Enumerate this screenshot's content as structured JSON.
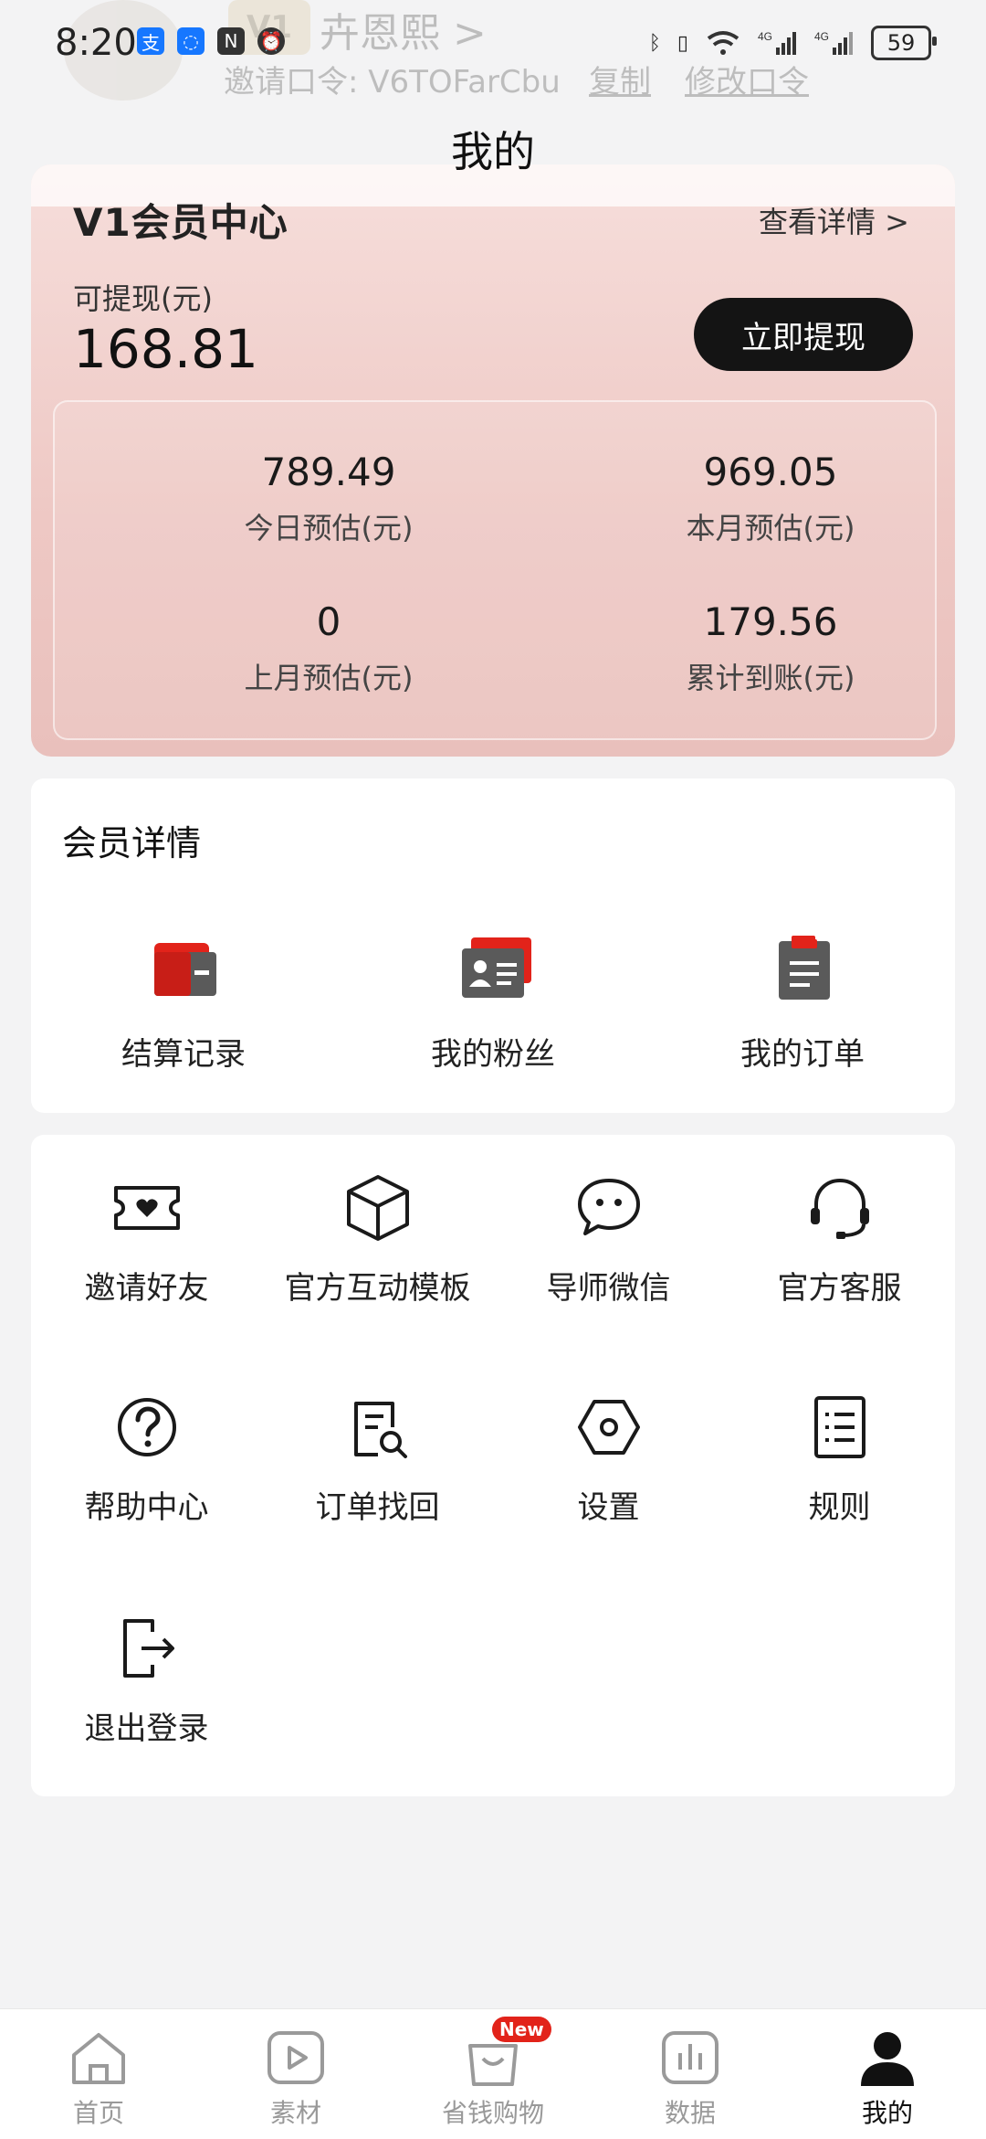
{
  "status_bar": {
    "time": "8:20",
    "battery": "59",
    "icons": [
      "alipay-icon",
      "bulb-icon",
      "nfc-icon",
      "alarm-icon",
      "bluetooth-icon",
      "vibrate-icon",
      "wifi-icon",
      "4g-signal-icon",
      "4g-signal-icon"
    ]
  },
  "profile_ghost": {
    "badge": "V1",
    "name": "卉恩熙 >",
    "invite": "邀请口令: V6TOFarCbu",
    "copy": "复制",
    "modify": "修改口令"
  },
  "page_title": "我的",
  "member_card": {
    "title": "V1会员中心",
    "detail_link": "查看详情 >",
    "withdraw_label": "可提现(元)",
    "withdraw_amount": "168.81",
    "withdraw_button": "立即提现",
    "stats": [
      {
        "value": "789.49",
        "label": "今日预估(元)"
      },
      {
        "value": "969.05",
        "label": "本月预估(元)"
      },
      {
        "value": "0",
        "label": "上月预估(元)"
      },
      {
        "value": "179.56",
        "label": "累计到账(元)"
      }
    ]
  },
  "member_details": {
    "title": "会员详情",
    "items": [
      {
        "label": "结算记录",
        "icon": "wallet-icon"
      },
      {
        "label": "我的粉丝",
        "icon": "id-card-icon"
      },
      {
        "label": "我的订单",
        "icon": "clipboard-icon"
      }
    ]
  },
  "tools": [
    {
      "label": "邀请好友",
      "icon": "ticket-heart-icon"
    },
    {
      "label": "官方互动模板",
      "icon": "cube-icon"
    },
    {
      "label": "导师微信",
      "icon": "chat-bubble-icon"
    },
    {
      "label": "官方客服",
      "icon": "headset-icon"
    },
    {
      "label": "帮助中心",
      "icon": "help-circle-icon"
    },
    {
      "label": "订单找回",
      "icon": "doc-search-icon"
    },
    {
      "label": "设置",
      "icon": "hexagon-settings-icon"
    },
    {
      "label": "规则",
      "icon": "list-doc-icon"
    },
    {
      "label": "退出登录",
      "icon": "logout-icon"
    }
  ],
  "bottom_nav": {
    "items": [
      {
        "label": "首页",
        "icon": "home-icon"
      },
      {
        "label": "素材",
        "icon": "play-icon"
      },
      {
        "label": "省钱购物",
        "icon": "shopping-bag-icon",
        "badge": "New"
      },
      {
        "label": "数据",
        "icon": "chart-icon"
      },
      {
        "label": "我的",
        "icon": "user-icon",
        "active": true
      }
    ]
  },
  "colors": {
    "accent_red": "#e2231a",
    "card_gradient_top": "#f6dedb",
    "card_gradient_bottom": "#e9c0bc",
    "button_dark": "#141414"
  }
}
